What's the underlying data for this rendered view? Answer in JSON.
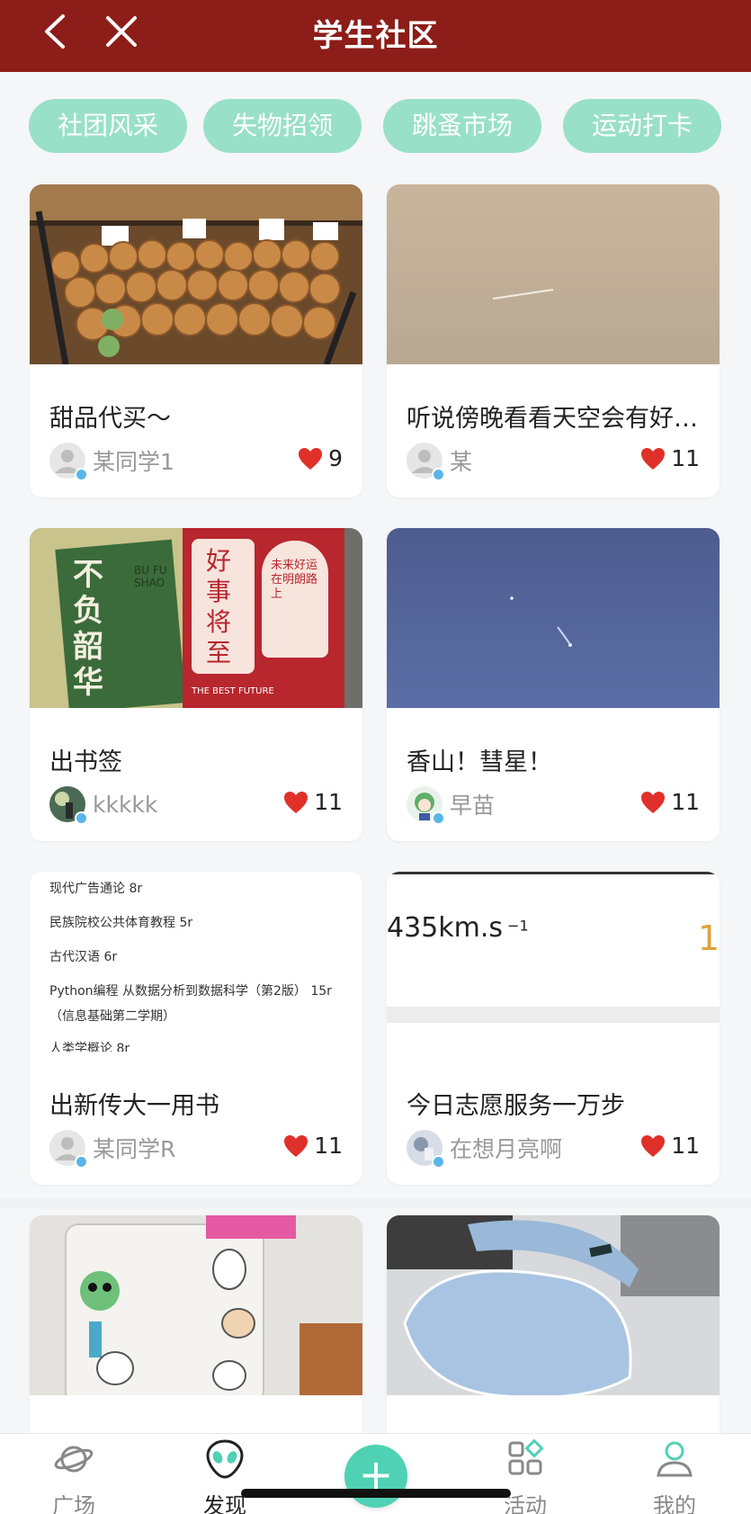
{
  "header": {
    "title": "学生社区"
  },
  "chips": [
    "社团风采",
    "失物招领",
    "跳蚤市场",
    "运动打卡"
  ],
  "posts": [
    {
      "title": "甜品代买～",
      "author": "某同学1",
      "likes": "9"
    },
    {
      "title": "听说傍晚看看天空会有好…",
      "author": "某",
      "likes": "11"
    },
    {
      "title": "出书签",
      "author": "kkkkk",
      "likes": "11"
    },
    {
      "title": "香山！彗星！",
      "author": "早苗",
      "likes": "11"
    },
    {
      "title": "出新传大一用书",
      "author": "某同学R",
      "likes": "11"
    },
    {
      "title": "今日志愿服务一万步",
      "author": "在想月亮啊",
      "likes": "11"
    },
    {
      "title": "",
      "author": "",
      "likes": ""
    },
    {
      "title": "",
      "author": "",
      "likes": ""
    }
  ],
  "bookmark": {
    "left_big": "不负韶华",
    "left_small": "BU FU SHAO",
    "right_big": "好事将至",
    "right_small": "未来好运在明朗路上",
    "right_en": "THE BEST FUTURE"
  },
  "booklist": [
    "现代广告通论 8r",
    "民族院校公共体育教程 5r",
    "古代汉语 6r",
    "Python编程 从数据分析到数据科学（第2版） 15r",
    "（信息基础第二学期）",
    "人类学概论 8r"
  ],
  "step_image": {
    "speed": "435km.s",
    "exp": "−1",
    "num": "1"
  },
  "nav": {
    "items": [
      "广场",
      "发现",
      "活动",
      "我的"
    ],
    "active": "发现",
    "plus": "+"
  },
  "colors": {
    "header": "#8c1d18",
    "chip": "#99e0c8",
    "accent": "#4fd1b3",
    "heart": "#e0302a"
  }
}
